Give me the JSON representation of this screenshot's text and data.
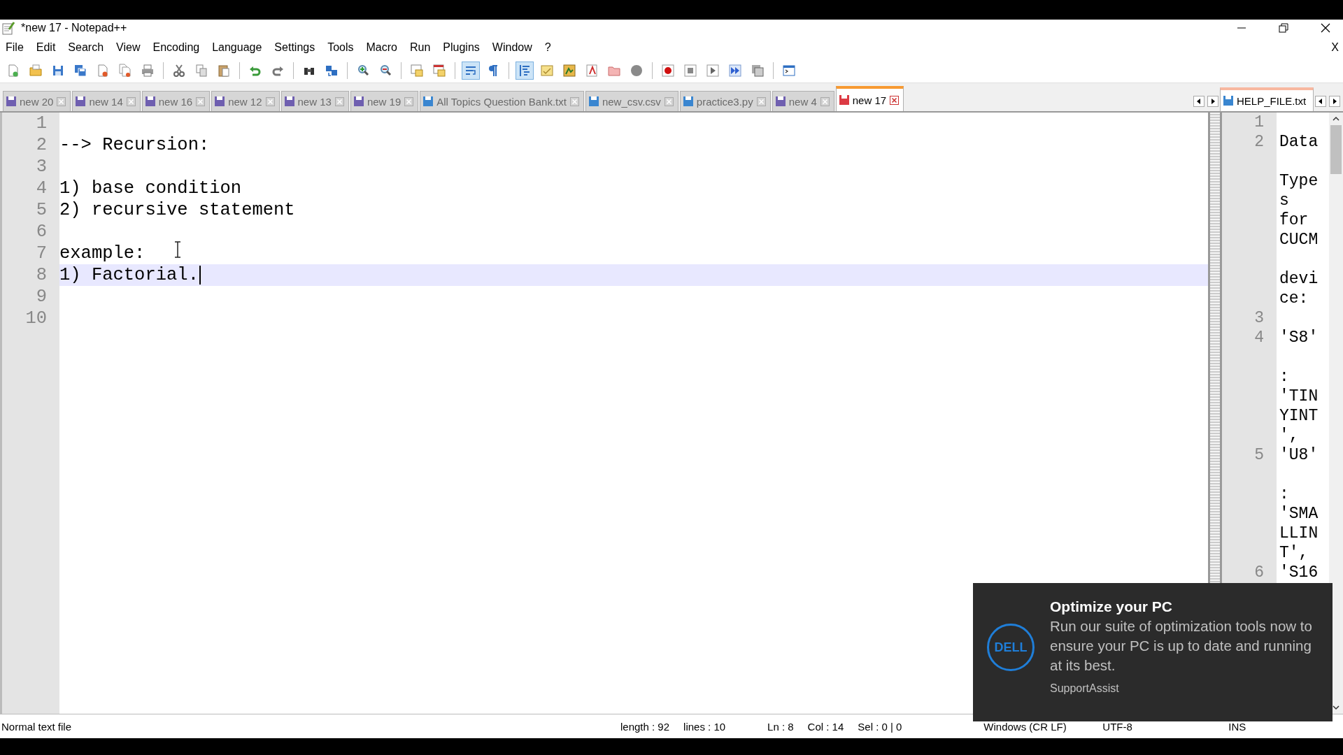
{
  "window": {
    "title": "*new 17 - Notepad++",
    "doc_close": "X"
  },
  "menu": [
    "File",
    "Edit",
    "Search",
    "View",
    "Encoding",
    "Language",
    "Settings",
    "Tools",
    "Macro",
    "Run",
    "Plugins",
    "Window",
    "?"
  ],
  "toolbar": [
    {
      "on": false
    },
    {
      "on": false
    },
    {
      "on": false
    },
    {
      "on": false
    },
    {
      "on": false
    },
    {
      "on": false
    },
    {
      "on": false
    },
    {
      "on": false
    },
    {
      "on": false
    },
    {
      "on": false
    },
    {
      "on": false
    },
    {
      "on": false
    },
    {
      "on": false
    },
    {
      "on": false
    },
    {
      "on": false
    },
    {
      "on": false
    },
    {
      "on": false
    },
    {
      "on": false
    },
    {
      "on": true
    },
    {
      "on": false
    },
    {
      "on": true
    },
    {
      "on": false
    },
    {
      "on": false
    },
    {
      "on": false
    },
    {
      "on": false
    },
    {
      "on": false
    },
    {
      "on": false
    },
    {
      "on": false
    },
    {
      "on": false
    },
    {
      "on": false
    },
    {
      "on": false
    },
    {
      "on": false
    }
  ],
  "tabs": [
    {
      "label": "new 20",
      "color": "#6f5fb0",
      "selected": false
    },
    {
      "label": "new 14",
      "color": "#6f5fb0",
      "selected": false
    },
    {
      "label": "new 16",
      "color": "#6f5fb0",
      "selected": false
    },
    {
      "label": "new 12",
      "color": "#6f5fb0",
      "selected": false
    },
    {
      "label": "new 13",
      "color": "#6f5fb0",
      "selected": false
    },
    {
      "label": "new 19",
      "color": "#6f5fb0",
      "selected": false
    },
    {
      "label": "All Topics Question Bank.txt",
      "color": "#3a86d0",
      "selected": false
    },
    {
      "label": "new_csv.csv",
      "color": "#3a86d0",
      "selected": false
    },
    {
      "label": "practice3.py",
      "color": "#3a86d0",
      "selected": false
    },
    {
      "label": "new 4",
      "color": "#6f5fb0",
      "selected": false
    },
    {
      "label": "new 17",
      "color": "#dc3b44",
      "selected": true
    }
  ],
  "second_tabs": [
    {
      "label": "HELP_FILE.txt",
      "color": "#3a86d0",
      "selected": true
    }
  ],
  "editor": {
    "lines": [
      {
        "number": "1",
        "current": false
      },
      {
        "number": "2",
        "text": "--> Recursion:",
        "current": false
      },
      {
        "number": "3",
        "current": false
      },
      {
        "number": "4",
        "text": "1) base condition",
        "current": false
      },
      {
        "number": "5",
        "text": "2) recursive statement",
        "current": false
      },
      {
        "number": "6",
        "current": false
      },
      {
        "number": "7",
        "text": "example:",
        "current": false
      },
      {
        "number": "8",
        "text": "1) Factorial.",
        "current": true
      },
      {
        "number": "9",
        "current": false
      },
      {
        "number": "10",
        "current": false
      }
    ]
  },
  "second_editor": {
    "lines": [
      {
        "number": "1"
      },
      {
        "number": "2",
        "rows": [
          {
            "text": "Data"
          },
          {
            "text": "Type",
            "space_before": true
          },
          {
            "text": "s"
          },
          {
            "text": "for"
          },
          {
            "text": "CUCM"
          },
          {
            "text": "devi",
            "space_before": true
          },
          {
            "text": "ce:"
          }
        ]
      },
      {
        "number": "3"
      },
      {
        "number": "4",
        "rows": [
          {
            "text": "'S8'"
          },
          {
            "text": ":",
            "space_before": true
          },
          {
            "text": "'TIN"
          },
          {
            "text": "YINT"
          },
          {
            "text": "',"
          }
        ]
      },
      {
        "number": "5",
        "rows": [
          {
            "text": "'U8'"
          },
          {
            "text": ":",
            "space_before": true
          },
          {
            "text": "'SMA"
          },
          {
            "text": "LLIN"
          },
          {
            "text": "T',"
          }
        ]
      },
      {
        "number": "6",
        "rows": [
          {
            "text": "'S16"
          }
        ]
      }
    ]
  },
  "status_bar": {
    "file_type": "Normal text file",
    "length": "length : 92",
    "lines": "lines : 10",
    "ln": "Ln : 8",
    "col": "Col : 14",
    "sel": "Sel : 0 | 0",
    "eol": "Windows (CR LF)",
    "encoding": "UTF-8",
    "mode": "INS"
  },
  "notification": {
    "logo": "DELL",
    "title": "Optimize your PC",
    "body": "Run our suite of optimization tools now to ensure your PC is up to date and running at its best.",
    "source": "SupportAssist"
  }
}
